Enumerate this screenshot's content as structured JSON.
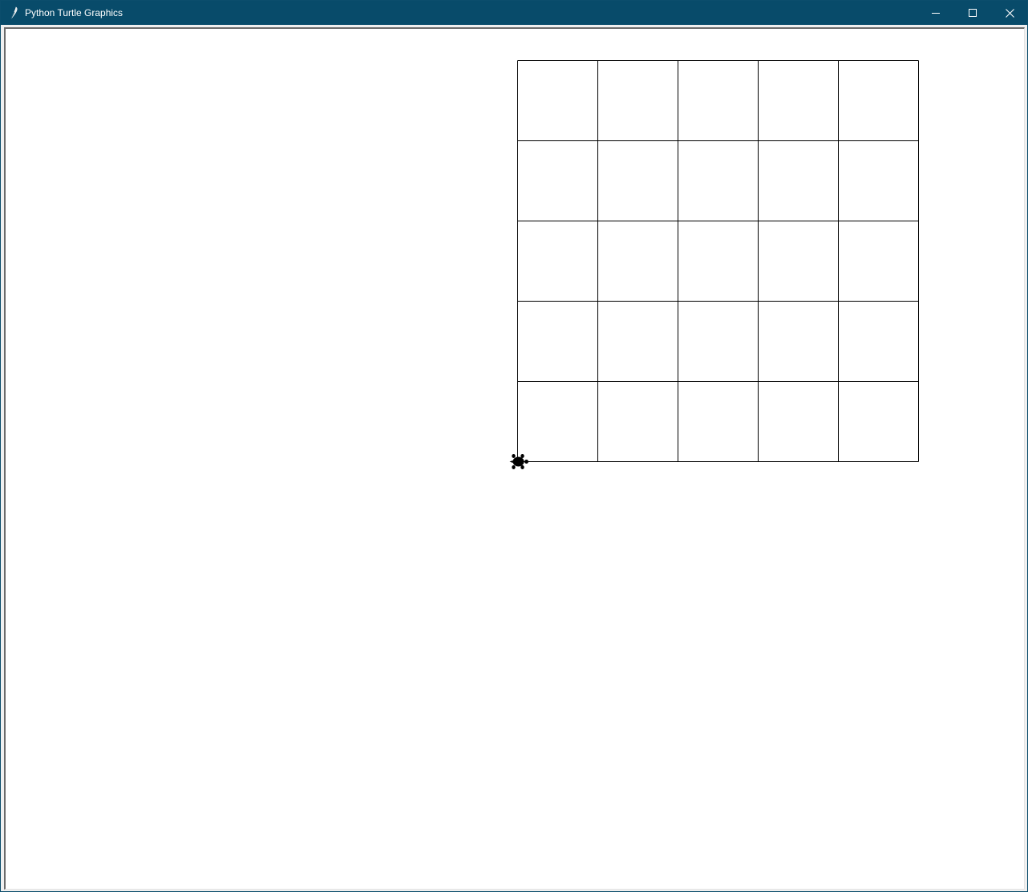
{
  "window": {
    "title": "Python Turtle Graphics",
    "app_icon": "feather-icon",
    "titlebar_color": "#084b6a",
    "controls": {
      "minimize": "minimize-icon",
      "maximize": "maximize-icon",
      "close": "close-icon"
    }
  },
  "canvas": {
    "background": "#ffffff",
    "drawing": {
      "shape": "grid",
      "rows": 5,
      "columns": 5,
      "line_color": "#000000"
    },
    "turtle": {
      "shape": "turtle-icon",
      "heading": "east",
      "color": "#000000",
      "location": "bottom-left corner of grid"
    }
  }
}
